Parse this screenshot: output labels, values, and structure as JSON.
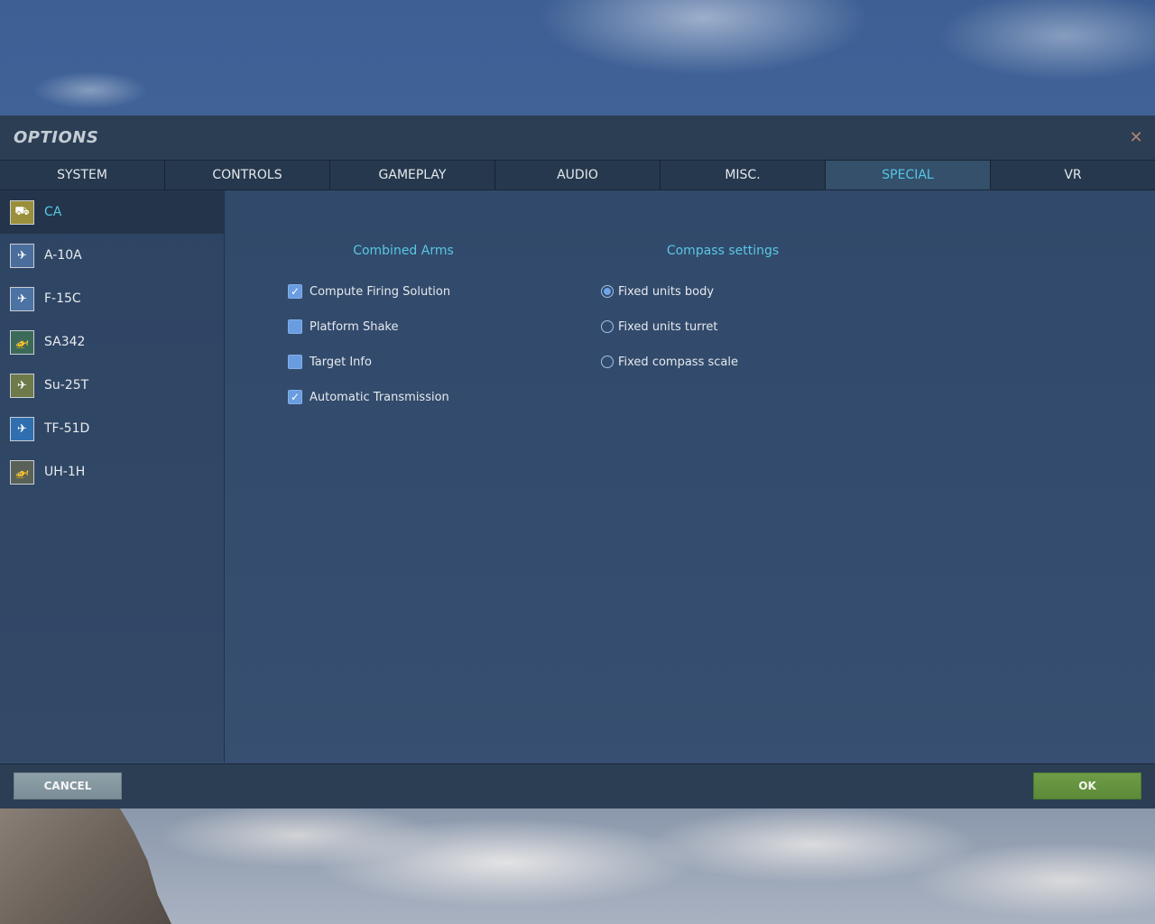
{
  "window": {
    "title": "OPTIONS",
    "close_glyph": "✕"
  },
  "tabs": [
    {
      "label": "SYSTEM"
    },
    {
      "label": "CONTROLS"
    },
    {
      "label": "GAMEPLAY"
    },
    {
      "label": "AUDIO"
    },
    {
      "label": "MISC."
    },
    {
      "label": "SPECIAL"
    },
    {
      "label": "VR"
    }
  ],
  "active_tab": "SPECIAL",
  "sidebar": {
    "items": [
      {
        "label": "CA",
        "icon": "ca-module-icon",
        "icon_glyph": "⛟",
        "icon_color": "#9a8f3a"
      },
      {
        "label": "A-10A",
        "icon": "a10a-module-icon",
        "icon_glyph": "✈",
        "icon_color": "#4a6d9c"
      },
      {
        "label": "F-15C",
        "icon": "f15c-module-icon",
        "icon_glyph": "✈",
        "icon_color": "#4d72a4"
      },
      {
        "label": "SA342",
        "icon": "sa342-module-icon",
        "icon_glyph": "🚁",
        "icon_color": "#3c6a58"
      },
      {
        "label": "Su-25T",
        "icon": "su25t-module-icon",
        "icon_glyph": "✈",
        "icon_color": "#6e7a4a"
      },
      {
        "label": "TF-51D",
        "icon": "tf51d-module-icon",
        "icon_glyph": "✈",
        "icon_color": "#2f6fb0"
      },
      {
        "label": "UH-1H",
        "icon": "uh1h-module-icon",
        "icon_glyph": "🚁",
        "icon_color": "#5a6258"
      }
    ],
    "active_item": "CA"
  },
  "combined_arms": {
    "heading": "Combined Arms",
    "options": [
      {
        "label": "Compute Firing Solution",
        "checked": true
      },
      {
        "label": "Platform Shake",
        "checked": false
      },
      {
        "label": "Target Info",
        "checked": false
      },
      {
        "label": "Automatic Transmission",
        "checked": true
      }
    ]
  },
  "compass": {
    "heading": "Compass settings",
    "options": [
      {
        "label": "Fixed units body",
        "selected": true
      },
      {
        "label": "Fixed units turret",
        "selected": false
      },
      {
        "label": "Fixed compass scale",
        "selected": false
      }
    ]
  },
  "footer": {
    "cancel_label": "CANCEL",
    "ok_label": "OK"
  },
  "colors": {
    "accent_cyan": "#56c6e6",
    "ok_green": "#5c8a38",
    "close_orange": "#b08472"
  },
  "check_glyph": "✓"
}
